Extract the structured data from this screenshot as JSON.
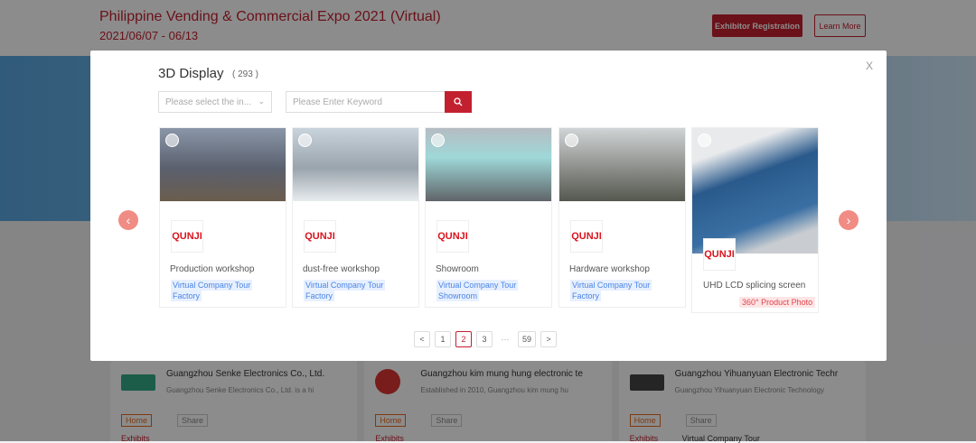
{
  "header": {
    "title": "Philippine Vending & Commercial Expo 2021 (Virtual)",
    "date": "2021/06/07 - 06/13",
    "register_label": "Exhibitor Registration",
    "learn_more_label": "Learn More"
  },
  "background_cards": [
    {
      "name": "Guangzhou Senke Electronics Co., Ltd.",
      "desc": "Guangzhou Senke Electronics Co., Ltd. is a hi",
      "home": "Home",
      "share": "Share",
      "exhibits": "Exhibits",
      "extra": ""
    },
    {
      "name": "Guangzhou kim mung hung electronic te",
      "desc": "Established in 2010, Guangzhou kim mung hu",
      "home": "Home",
      "share": "Share",
      "exhibits": "Exhibits",
      "extra": ""
    },
    {
      "name": "Guangzhou Yihuanyuan Electronic Techr",
      "desc": "Guangzhou Yihuanyuan Electronic Technology",
      "home": "Home",
      "share": "Share",
      "exhibits": "Exhibits",
      "extra": "Virtual Company Tour"
    }
  ],
  "modal": {
    "title": "3D Display",
    "count": "( 293 )",
    "close": "X",
    "select_placeholder": "Please select the in...",
    "keyword_placeholder": "Please Enter Keyword",
    "cards": [
      {
        "brand": "QUNJI",
        "name": "Production workshop",
        "tag1": "Virtual Company Tour",
        "tag2": "Factory"
      },
      {
        "brand": "QUNJI",
        "name": "dust-free workshop",
        "tag1": "Virtual Company Tour",
        "tag2": "Factory"
      },
      {
        "brand": "QUNJI",
        "name": "Showroom",
        "tag1": "Virtual Company Tour",
        "tag2": "Showroom"
      },
      {
        "brand": "QUNJI",
        "name": "Hardware workshop",
        "tag1": "Virtual Company Tour",
        "tag2": "Factory"
      },
      {
        "brand": "QUNJI",
        "name": "UHD LCD splicing screen",
        "tag": "360° Product Photo"
      }
    ],
    "pagination": {
      "prev": "<",
      "pages": [
        "1",
        "2",
        "3"
      ],
      "ellipsis": "···",
      "last": "59",
      "next": ">",
      "current": "2"
    }
  },
  "colors": {
    "brand": "#c3202f",
    "tag_blue": "#4a84e6",
    "arrow": "#f08c84"
  }
}
